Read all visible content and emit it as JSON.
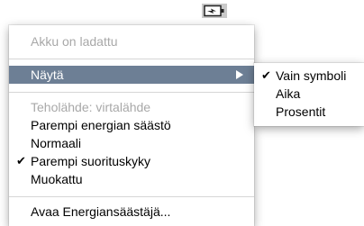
{
  "menubar": {
    "battery_icon": "battery-charging-icon"
  },
  "menu": {
    "status": "Akku on ladattu",
    "show": "Näytä",
    "power_source": "Teholähde: virtalähde",
    "options": [
      {
        "label": "Parempi energian säästö",
        "checked": false
      },
      {
        "label": "Normaali",
        "checked": false
      },
      {
        "label": "Parempi suorituskyky",
        "checked": true
      },
      {
        "label": "Muokattu",
        "checked": false
      }
    ],
    "open_energy_saver": "Avaa Energiansäästäjä...",
    "check_mark": "✔"
  },
  "submenu": {
    "items": [
      {
        "label": "Vain symboli",
        "checked": true
      },
      {
        "label": "Aika",
        "checked": false
      },
      {
        "label": "Prosentit",
        "checked": false
      }
    ]
  },
  "colors": {
    "selection": "#6d7f95",
    "disabled_text": "#a8a8a8",
    "menubar_icon_bg": "#c9c9c9"
  }
}
